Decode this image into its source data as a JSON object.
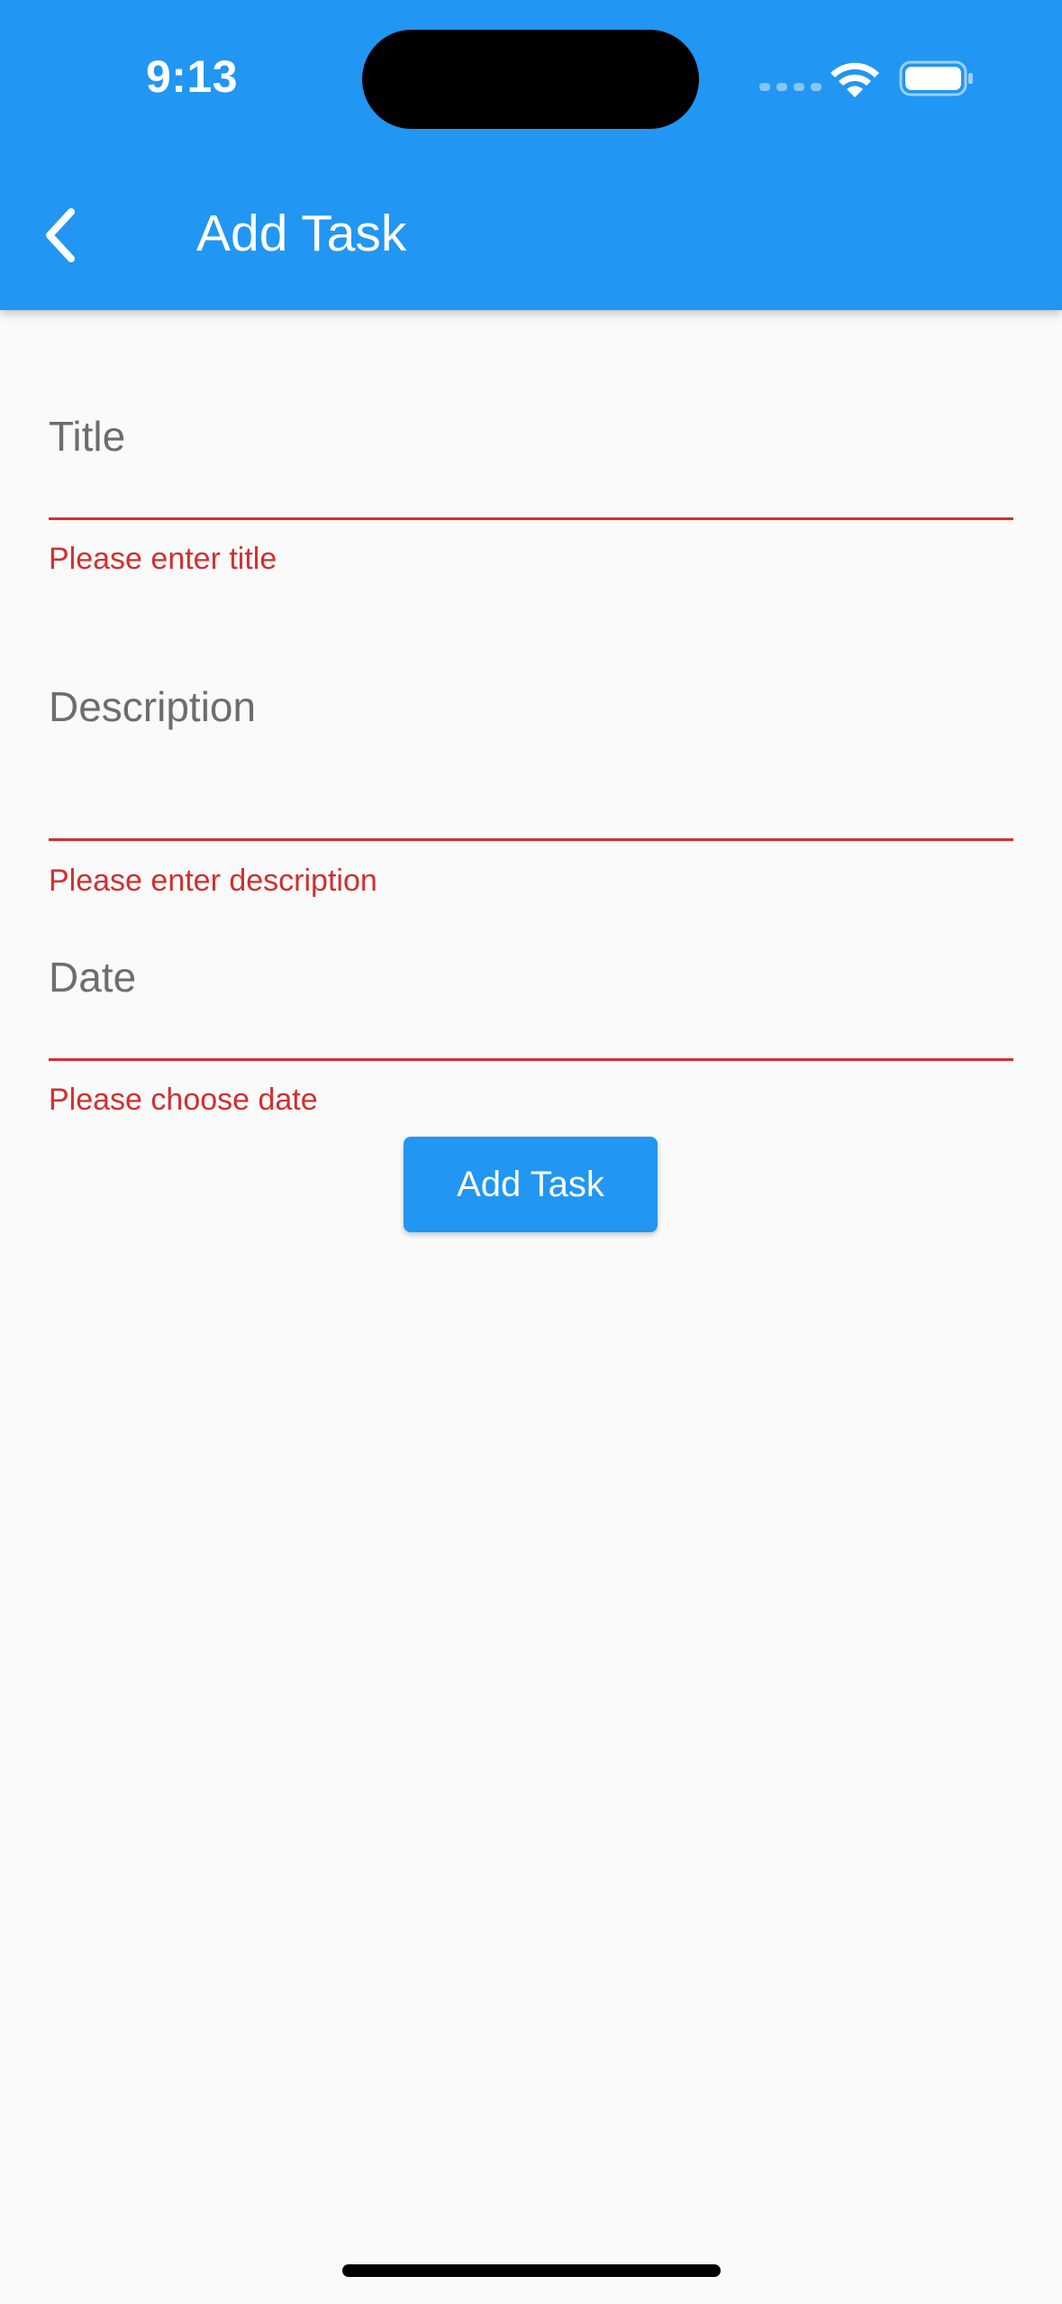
{
  "status_bar": {
    "time": "9:13"
  },
  "app_bar": {
    "back_icon": "chevron-left-icon",
    "title": "Add Task"
  },
  "form": {
    "title_field": {
      "label": "Title",
      "error": "Please enter title"
    },
    "description_field": {
      "label": "Description",
      "error": "Please enter description"
    },
    "date_field": {
      "label": "Date",
      "error": "Please choose date"
    },
    "submit_label": "Add Task"
  },
  "colors": {
    "app_bar": "#2196f3",
    "error": "#d32f2f",
    "background": "#fafafa",
    "label": "#6d6d6d"
  }
}
